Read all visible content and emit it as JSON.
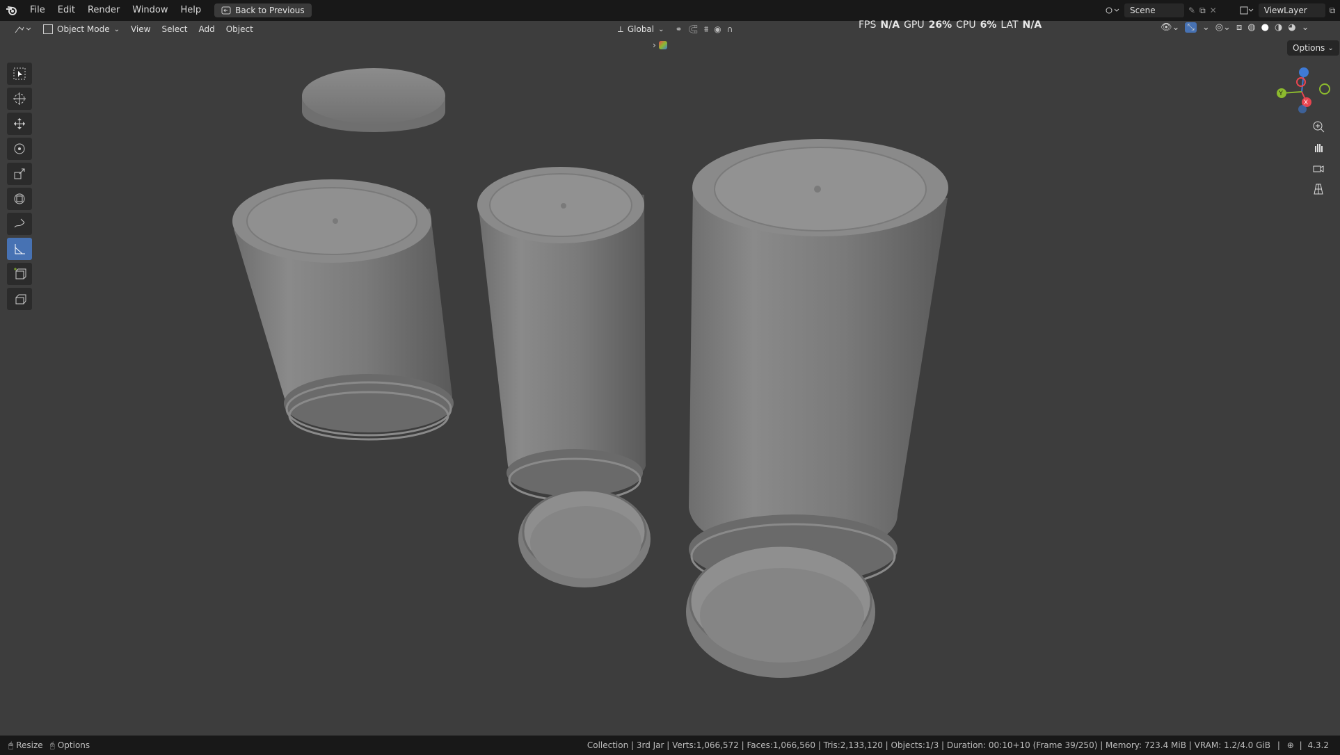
{
  "menu": {
    "items": [
      "File",
      "Edit",
      "Render",
      "Window",
      "Help"
    ],
    "back_label": "Back to Previous"
  },
  "workspace": {
    "scene": "Scene",
    "view_layer": "ViewLayer"
  },
  "viewport_header": {
    "mode": "Object Mode",
    "menus": [
      "View",
      "Select",
      "Add",
      "Object"
    ],
    "transform": "Global",
    "options_label": "Options"
  },
  "stats": {
    "fps_label": "FPS",
    "fps_value": "N/A",
    "gpu_label": "GPU",
    "gpu_value": "26%",
    "cpu_label": "CPU",
    "cpu_value": "6%",
    "lat_label": "LAT",
    "lat_value": "N/A"
  },
  "tools": [
    "select-box-icon",
    "cursor-icon",
    "move-icon",
    "rotate-icon",
    "scale-icon",
    "transform-icon",
    "annotate-icon",
    "measure-icon",
    "add-cube-icon",
    "extrude-icon"
  ],
  "gizmo": {
    "x": "X",
    "y": "Y",
    "z": "Z"
  },
  "statusbar": {
    "resize": "Resize",
    "options": "Options",
    "info": "Collection | 3rd Jar | Verts:1,066,572 | Faces:1,066,560 | Tris:2,133,120 | Objects:1/3 | Duration: 00:10+10 (Frame 39/250) | Memory: 723.4 MiB | VRAM: 1.2/4.0 GiB",
    "version": "4.3.2"
  },
  "colors": {
    "accent": "#4772b3",
    "viewport_bg": "#3d3d3d",
    "axis_x": "#e94550",
    "axis_y": "#8cba2e",
    "axis_z": "#3e7ad6"
  }
}
